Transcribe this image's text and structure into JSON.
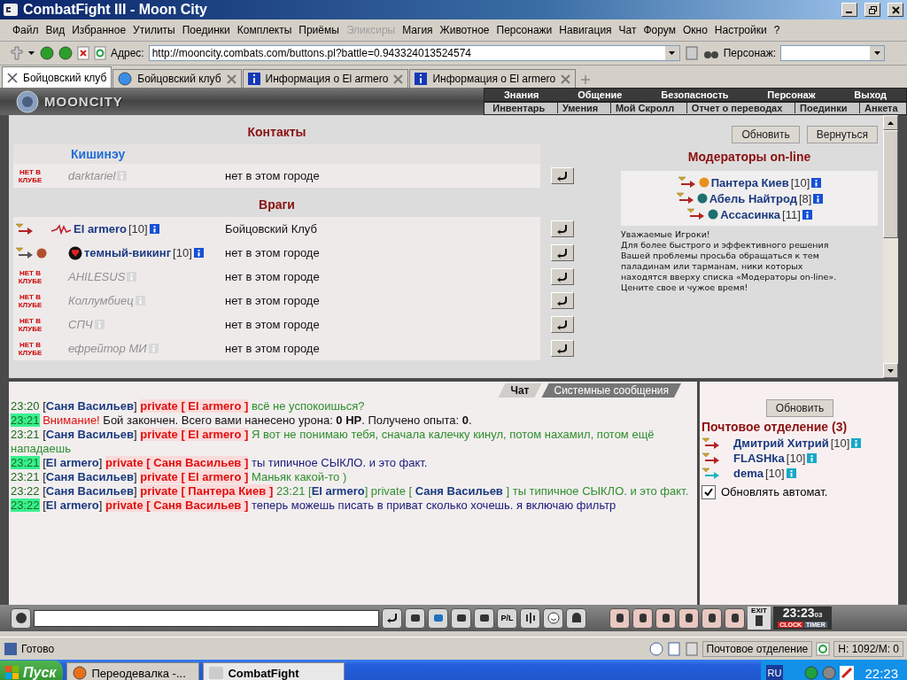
{
  "window": {
    "title": "CombatFight III - Moon City"
  },
  "menu": [
    {
      "label": "Файл",
      "disabled": false
    },
    {
      "label": "Вид",
      "disabled": false
    },
    {
      "label": "Избранное",
      "disabled": false
    },
    {
      "label": "Утилиты",
      "disabled": false
    },
    {
      "label": "Поединки",
      "disabled": false
    },
    {
      "label": "Комплекты",
      "disabled": false
    },
    {
      "label": "Приёмы",
      "disabled": false
    },
    {
      "label": "Эликсиры",
      "disabled": true
    },
    {
      "label": "Магия",
      "disabled": false
    },
    {
      "label": "Животное",
      "disabled": false
    },
    {
      "label": "Персонажи",
      "disabled": false
    },
    {
      "label": "Навигация",
      "disabled": false
    },
    {
      "label": "Чат",
      "disabled": false
    },
    {
      "label": "Форум",
      "disabled": false
    },
    {
      "label": "Окно",
      "disabled": false
    },
    {
      "label": "Настройки",
      "disabled": false
    },
    {
      "label": "?",
      "disabled": false
    }
  ],
  "address_bar": {
    "label": "Адрес:",
    "value": "http://mooncity.combats.com/buttons.pl?battle=0.943324013524574"
  },
  "character_select": {
    "label": "Персонаж:"
  },
  "tabs": [
    {
      "label": "Бойцовский клуб",
      "selected": true,
      "kind": "page"
    },
    {
      "label": "Бойцовский клуб",
      "selected": false,
      "kind": "web"
    },
    {
      "label": "Информация о El armero",
      "selected": false,
      "kind": "info"
    },
    {
      "label": "Информация о El armero",
      "selected": false,
      "kind": "info"
    }
  ],
  "game_header": {
    "logo": "MOONCITY",
    "top_links": [
      "Знания",
      "Общение",
      "Безопасность",
      "Персонаж",
      "Выход"
    ],
    "bottom_links": [
      "Инвентарь",
      "Умения",
      "Мой Скролл",
      "Отчет о переводах",
      "Поединки",
      "Анкета"
    ]
  },
  "contacts": {
    "title": "Контакты",
    "groups": [
      {
        "name": "Кишинэу",
        "rows": [
          {
            "name": "darktariel",
            "online": false,
            "badge": "НЕТ В КЛУБЕ",
            "location": "нет в этом городе"
          }
        ]
      }
    ]
  },
  "enemies": {
    "title": "Враги",
    "rows": [
      {
        "name": "El armero",
        "level": "[10]",
        "online": true,
        "kind": "sign",
        "location": "Бойцовский Клуб"
      },
      {
        "name": "темный-викинг",
        "level": "[10]",
        "online": true,
        "kind": "clan",
        "location": "нет в этом городе"
      },
      {
        "name": "AHILESUS",
        "online": false,
        "badge": "НЕТ В КЛУБЕ",
        "location": "нет в этом городе"
      },
      {
        "name": "Коллумбиец",
        "online": false,
        "badge": "НЕТ В КЛУБЕ",
        "location": "нет в этом городе"
      },
      {
        "name": "СПЧ",
        "online": false,
        "badge": "НЕТ В КЛУБЕ",
        "location": "нет в этом городе"
      },
      {
        "name": "ефрейтор МИ",
        "online": false,
        "badge": "НЕТ В КЛУБЕ",
        "location": "нет в этом городе"
      }
    ]
  },
  "page_buttons": [
    "Обновить",
    "Вернуться"
  ],
  "moderators": {
    "title": "Модераторы on-line",
    "items": [
      {
        "name": "Пантера Киев",
        "level": "[10]",
        "color": "#e8901c"
      },
      {
        "name": "Абель Найтрод",
        "level": "[8]",
        "color": "#1c7070"
      },
      {
        "name": "Ассасинка",
        "level": "[11]",
        "color": "#1c7070"
      }
    ],
    "notice": [
      "Уважаемые Игроки!",
      "Для более быстрого и эффективного решения",
      "Вашей проблемы просьба обращаться к тем",
      "паладинам или тарманам, ники которых",
      "находятся вверху списка «Модераторы on-line».",
      "Цените свое и чужое время!"
    ]
  },
  "chat": {
    "tabs": [
      {
        "label": "Чат",
        "selected": true
      },
      {
        "label": "Системные сообщения",
        "selected": false
      }
    ],
    "messages": [
      {
        "time": "23:20",
        "highlighted": false,
        "parts": [
          {
            "kind": "sender",
            "text": "[**Саня Васильев**]"
          },
          {
            "kind": "private",
            "text": "private [ El armero ]"
          },
          {
            "kind": "text",
            "color": "#2f8f2f",
            "text": "всё не успокоишься?"
          }
        ]
      },
      {
        "time": "23:21",
        "highlighted": true,
        "parts": [
          {
            "kind": "alert",
            "text": "Внимание!"
          },
          {
            "kind": "system",
            "text": "Бой закончен. Всего вами нанесено урона: **0 HP**. Получено опыта: **0**."
          }
        ]
      },
      {
        "time": "23:21",
        "highlighted": false,
        "parts": [
          {
            "kind": "sender",
            "text": "[**Саня Васильев**]"
          },
          {
            "kind": "private",
            "text": "private [ El armero ]"
          },
          {
            "kind": "text",
            "color": "#2f8f2f",
            "text": "Я вот не понимаю тебя, сначала калечку кинул, потом нахамил, потом ещё нападаешь"
          }
        ]
      },
      {
        "time": "23:21",
        "highlighted": true,
        "parts": [
          {
            "kind": "sender",
            "text": "[**El armero**]"
          },
          {
            "kind": "private",
            "text": "private [ Саня Васильев ]"
          },
          {
            "kind": "text",
            "color": "#1a1a7a",
            "text": "ты типичное СЫКЛО. и это факт."
          }
        ]
      },
      {
        "time": "23:21",
        "highlighted": false,
        "parts": [
          {
            "kind": "sender",
            "text": "[**Саня Васильев**]"
          },
          {
            "kind": "private",
            "text": "private [ El armero ]"
          },
          {
            "kind": "text",
            "color": "#2f8f2f",
            "text": "Маньяк какой-то )"
          }
        ]
      },
      {
        "time": "23:22",
        "highlighted": false,
        "parts": [
          {
            "kind": "sender",
            "text": "[**Саня Васильев**]"
          },
          {
            "kind": "private",
            "text": "private [ Пантера Киев ]"
          },
          {
            "kind": "text",
            "color": "#2f8f2f",
            "text": "23:21 [**El armero**] private [ **Саня Васильев** ] ты типичное СЫКЛО. и это факт."
          }
        ]
      },
      {
        "time": "23:22",
        "highlighted": true,
        "parts": [
          {
            "kind": "sender",
            "text": "[**El armero**]"
          },
          {
            "kind": "private",
            "text": "private [ Саня Васильев ]"
          },
          {
            "kind": "text",
            "color": "#1a1a7a",
            "text": "теперь можешь писать в приват сколько хочешь. я включаю фильтр"
          }
        ]
      }
    ]
  },
  "mail": {
    "button": "Обновить",
    "title": "Почтовое отделение (3)",
    "items": [
      {
        "name": "Дмитрий Хитрий",
        "level": "[10]",
        "color": "#b22222"
      },
      {
        "name": "FLASHka",
        "level": "[10]",
        "color": "#b22222"
      },
      {
        "name": "dema",
        "level": "[10]",
        "color": "#20b2c0"
      }
    ],
    "auto_refresh": {
      "label": "Обновлять автомат.",
      "checked": true
    }
  },
  "toolbar": {
    "pl_label": "P/L",
    "exit_label": "EXIT",
    "clock": {
      "time": "23:23",
      "seconds": "03",
      "clock_label": "CLOCK",
      "timer_label": "TIMER"
    }
  },
  "status_bar": {
    "text": "Готово",
    "panel": "Почтовое отделение",
    "counter": "H: 1092/M: 0"
  },
  "taskbar": {
    "start": "Пуск",
    "tasks": [
      {
        "label": "Переодевалка -...",
        "selected": false,
        "kind": "firefox"
      },
      {
        "label": "CombatFight",
        "selected": true,
        "kind": "cf"
      }
    ],
    "language": "RU",
    "time": "22:23"
  }
}
